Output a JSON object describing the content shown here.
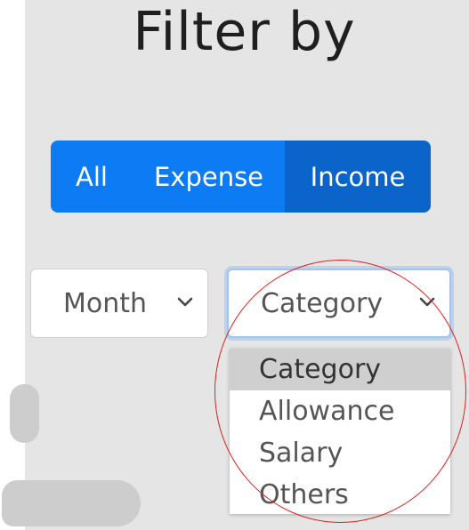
{
  "title": "Filter by",
  "type_filter": {
    "options": [
      "All",
      "Expense",
      "Income"
    ],
    "active": "Income"
  },
  "month_select": {
    "value": "Month"
  },
  "category_select": {
    "value": "Category",
    "options": [
      "Category",
      "Allowance",
      "Salary",
      "Others"
    ],
    "highlighted": "Category"
  },
  "colors": {
    "primary": "#0d7bf3",
    "primary_active": "#0a64c9",
    "panel_bg": "#e5e5e5",
    "annotation_circle": "#e02020"
  }
}
